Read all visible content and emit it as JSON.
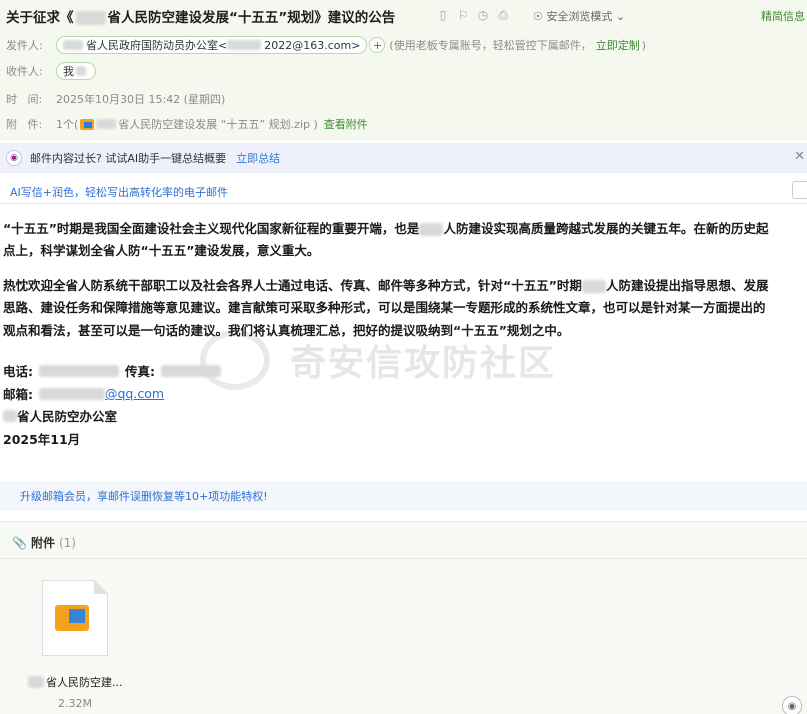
{
  "header": {
    "subject": "关于征求《    省人民防空建设发展“十五五”规划》建议的公告",
    "subject_prefix": "关于征求《",
    "subject_suffix": "省人民防空建设发展“十五五”规划》建议的公告",
    "toolbar_icons": [
      "bookmark-icon",
      "flag-icon",
      "clock-icon",
      "print-icon"
    ],
    "safe_mode_label": "安全浏览模式",
    "fanjian_label": "精简信息",
    "from_label": "发件人:",
    "from_name": "省人民政府国防动员办公室<",
    "from_addr_suffix": "2022@163.com>",
    "from_note": "(使用老板专属账号，轻松管控下属邮件，",
    "from_customize": "立即定制",
    "from_note_end": ")",
    "to_label": "收件人:",
    "to_name": "我",
    "time_label": "时   间:",
    "time_value": "2025年10月30日 15:42 (星期四)",
    "attach_label": "附   件:",
    "attach_count": "1个(",
    "attach_name": "省人民防空建设发展 “十五五” 规划.zip )",
    "attach_view": "查看附件"
  },
  "ai": {
    "prompt": "邮件内容过长? 试试AI助手一键总结概要",
    "link": "立即总结",
    "write": "AI写信+润色，轻松写出高转化率的电子邮件"
  },
  "body": {
    "p1_l1a": "“十五五”时期是我国全面建设社会主义现代化国家新征程的重要开端，也是",
    "p1_l1b": "人防建设实现高质量跨越式发展的关键五年。在新的历史起",
    "p1_l2": "点上，科学谋划全省人防“十五五”建设发展，意义重大。",
    "p2_l1a": "热忱欢迎全省人防系统干部职工以及社会各界人士通过电话、传真、邮件等多种方式，针对“十五五”时期",
    "p2_l1b": "人防建设提出指导思想、发展",
    "p2_l2": "思路、建设任务和保障措施等意见建议。建言献策可采取多种形式，可以是围绕某一专题形成的系统性文章，也可以是针对某一方面提出的",
    "p2_l3": "观点和看法，甚至可以是一句话的建议。我们将认真梳理汇总，把好的提议吸纳到“十五五”规划之中。",
    "phone_label": "电话:",
    "fax_label": "传真:",
    "mail_label": "邮箱:",
    "mail_domain": "@qq.com",
    "office": "省人民防空办公室",
    "date": "2025年11月"
  },
  "watermark": "奇安信攻防社区",
  "upgrade": "升级邮箱会员，享邮件误删恢复等10+项功能特权!",
  "attachments": {
    "title": "附件",
    "count": "(1)",
    "file_name": "省人民防空建...",
    "file_size": "2.32M"
  }
}
